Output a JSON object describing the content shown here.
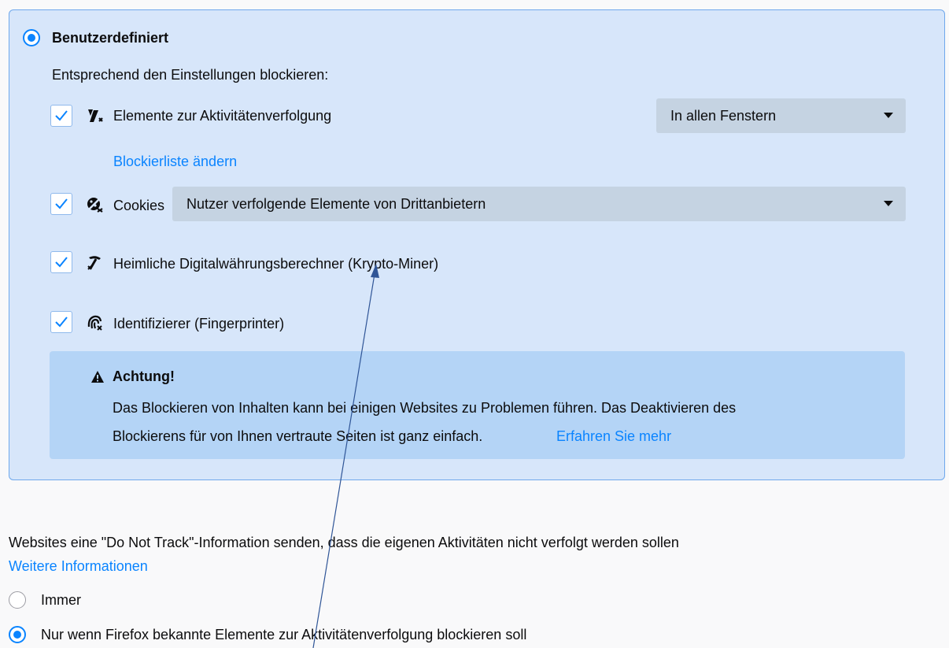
{
  "custom": {
    "radio_label": "Benutzerdefiniert",
    "description": "Entsprechend den Einstellungen blockieren:",
    "tracking": {
      "label": "Elemente zur Aktivitätenverfolgung",
      "checked": true,
      "select_value": "In allen Fenstern",
      "blocklist_link": "Blockierliste ändern"
    },
    "cookies": {
      "label": "Cookies",
      "checked": true,
      "select_value": "Nutzer verfolgende Elemente von Drittanbietern"
    },
    "cryptominers": {
      "label": "Heimliche Digitalwährungsberechner (Krypto-Miner)",
      "checked": true
    },
    "fingerprinters": {
      "label": "Identifizierer (Fingerprinter)",
      "checked": true
    },
    "warning": {
      "title": "Achtung!",
      "line1": "Das Blockieren von Inhalten kann bei einigen Websites zu Problemen führen. Das Deaktivieren des",
      "line2": "Blockierens für von Ihnen vertraute Seiten ist ganz einfach.",
      "link": "Erfahren Sie mehr"
    }
  },
  "dnt": {
    "description": "Websites eine \"Do Not Track\"-Information senden, dass die eigenen Aktivitäten nicht verfolgt werden sollen",
    "more_info_link": "Weitere Informationen",
    "options": [
      {
        "label": "Immer",
        "selected": false
      },
      {
        "label": "Nur wenn Firefox bekannte Elemente zur Aktivitätenverfolgung blockieren soll",
        "selected": true
      }
    ]
  },
  "colors": {
    "accent": "#0a84ff",
    "panel_bg": "#d7e6fa",
    "warning_bg": "#b4d4f6",
    "annotation_arrow": "#2f5597"
  },
  "icons": [
    "tracker-icon",
    "cookie-icon",
    "cryptominer-icon",
    "fingerprint-icon",
    "warning-icon",
    "dropdown-arrow-icon",
    "checkmark-icon"
  ]
}
